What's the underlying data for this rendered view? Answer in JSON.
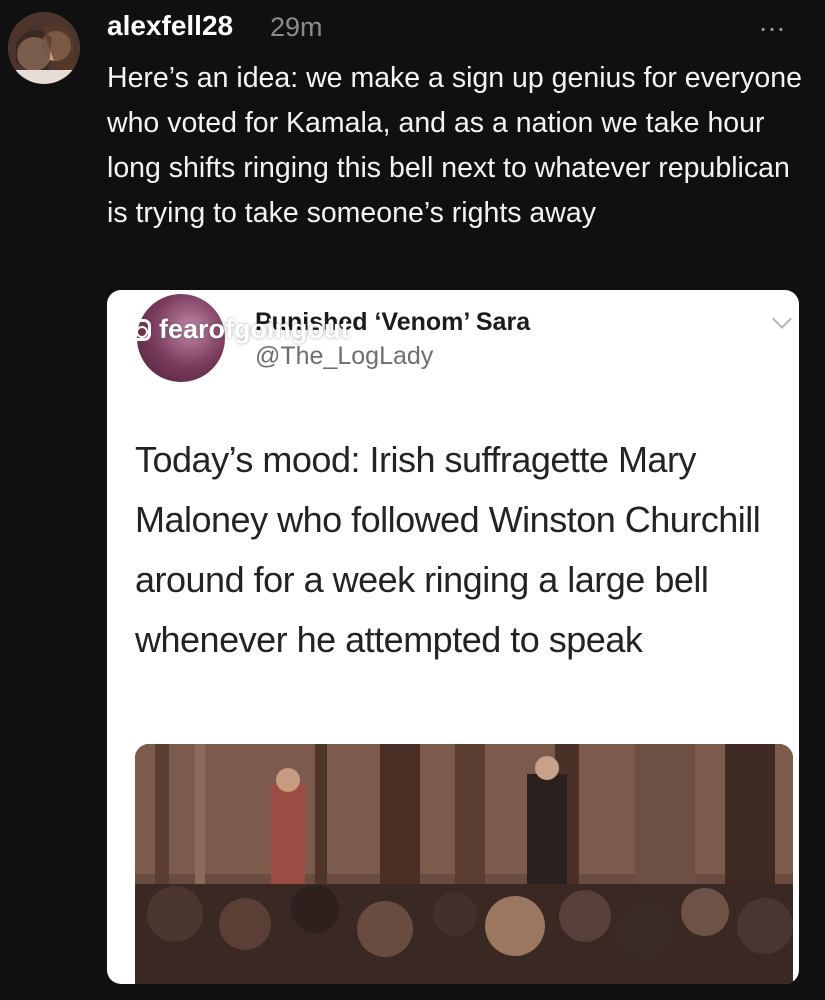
{
  "post": {
    "username": "alexfell28",
    "time": "29m",
    "more_icon": "…",
    "text": "Here’s an idea: we make a sign up genius for everyone who voted for Kamala, and as a nation we take hour long shifts ringing this bell next to whatever republican is trying to take someone’s rights away"
  },
  "embed": {
    "watermark": "fearofgoingout",
    "display_name": "Punished ‘Venom’ Sara",
    "handle": "@The_LogLady",
    "text": "Today’s mood: Irish suffragette Mary Maloney who followed Winston Churchill around for a week ringing a large bell whenever he attempted to speak"
  },
  "colors": {
    "background": "#101010",
    "card": "#ffffff",
    "muted": "#8b8b8b"
  }
}
